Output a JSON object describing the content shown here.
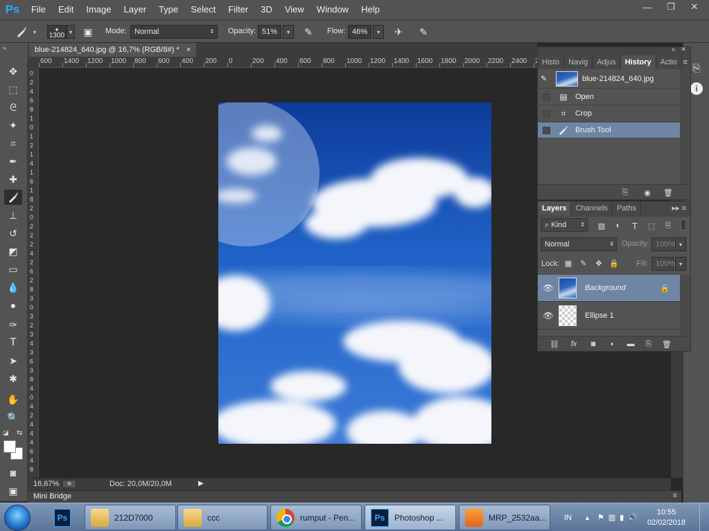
{
  "app": {
    "logo": "Ps",
    "menu": [
      "File",
      "Edit",
      "Image",
      "Layer",
      "Type",
      "Select",
      "Filter",
      "3D",
      "View",
      "Window",
      "Help"
    ],
    "window_controls": {
      "minimize": "—",
      "restore": "❐",
      "close": "✕"
    }
  },
  "options": {
    "brush_size": "1300",
    "mode_label": "Mode:",
    "mode_value": "Normal",
    "opacity_label": "Opacity:",
    "opacity_value": "51%",
    "flow_label": "Flow:",
    "flow_value": "46%"
  },
  "document": {
    "tab_title": "blue-214824_640.jpg @ 16,7% (RGB/8#) *",
    "tab_close": "×",
    "ruler_top": [
      "600",
      "1400",
      "1200",
      "1000",
      "800",
      "600",
      "400",
      "200",
      "0",
      "200",
      "400",
      "600",
      "800",
      "1000",
      "1200",
      "1400",
      "1600",
      "1800",
      "2000",
      "2200",
      "2400",
      "2600"
    ],
    "ruler_left": [
      "0",
      "2",
      "4",
      "6",
      "8",
      "1",
      "0",
      "1",
      "2",
      "1",
      "4",
      "1",
      "6",
      "1",
      "8",
      "2",
      "0",
      "2",
      "2",
      "2",
      "4",
      "2",
      "6",
      "2",
      "8",
      "3",
      "0",
      "3",
      "2",
      "3",
      "4",
      "3",
      "6",
      "3",
      "8",
      "4",
      "0",
      "4",
      "2",
      "4",
      "4",
      "4",
      "6",
      "4",
      "8"
    ]
  },
  "status": {
    "zoom": "16,67%",
    "doc_info": "Doc: 20,0M/20,0M"
  },
  "mini_bridge": "Mini Bridge",
  "history": {
    "tabs": [
      "Histo",
      "Navig",
      "Adjus",
      "History",
      "Actio"
    ],
    "active_tab": "History",
    "snapshot": "blue-214824_640.jpg",
    "steps": [
      {
        "label": "Open",
        "icon": "document-icon"
      },
      {
        "label": "Crop",
        "icon": "crop-icon"
      },
      {
        "label": "Brush Tool",
        "icon": "brush-icon"
      }
    ],
    "selected_step": "Brush Tool"
  },
  "layers": {
    "tabs": [
      "Layers",
      "Channels",
      "Paths"
    ],
    "active_tab": "Layers",
    "filter_kind": "Kind",
    "blend_mode": "Normal",
    "opacity_label": "Opacity:",
    "opacity_value": "100%",
    "lock_label": "Lock:",
    "fill_label": "Fill:",
    "fill_value": "100%",
    "items": [
      {
        "name": "Background",
        "selected": true,
        "locked": true
      },
      {
        "name": "Ellipse 1",
        "selected": false,
        "locked": false
      }
    ]
  },
  "taskbar": {
    "tasks": [
      {
        "label": "212D7000",
        "icon": "folder-icon"
      },
      {
        "label": "ccc",
        "icon": "folder-icon"
      },
      {
        "label": "rumput - Pen...",
        "icon": "chrome-icon"
      },
      {
        "label": "Photoshop ...",
        "icon": "photoshop-icon"
      },
      {
        "label": "MRP_2532aa...",
        "icon": "camera-app-icon"
      }
    ],
    "pinned_ps": "Ps",
    "language": "IN",
    "time": "10:55",
    "date": "02/02/2018"
  },
  "colors": {
    "ui_dark": "#282828",
    "ui_panel": "#535353",
    "selection": "#6e86a4",
    "ps_blue": "#31a8ff",
    "sky_blue": "#1f5fc4"
  }
}
